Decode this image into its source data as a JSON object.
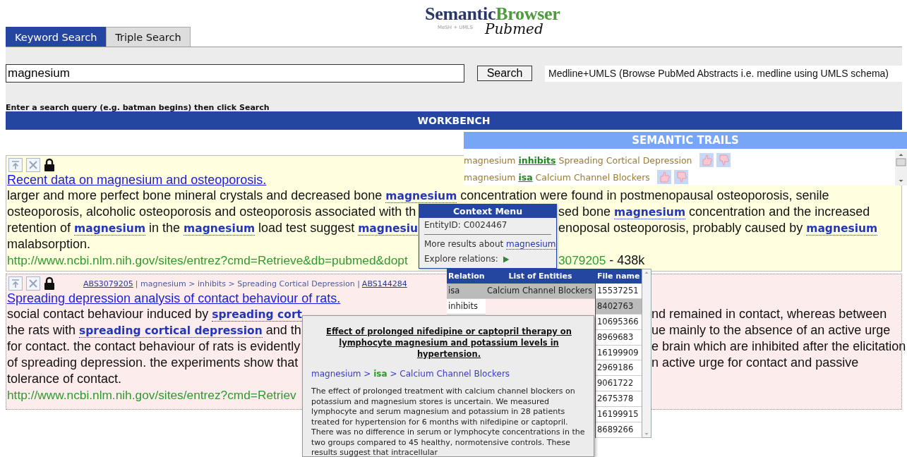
{
  "logo": {
    "title_parts": [
      "Semantic",
      "Browser"
    ],
    "tagline": "MeSH + UMLS",
    "script": "Pubmed"
  },
  "tabs": [
    {
      "label": "Keyword Search",
      "selected": true
    },
    {
      "label": "Triple Search",
      "selected": false
    }
  ],
  "search": {
    "value": "magnesium",
    "button": "Search",
    "source": "Medline+UMLS (Browse PubMed Abstracts i.e. medline using UMLS schema)",
    "hint": "Enter a search query (e.g. batman begins) then click Search"
  },
  "workbench": {
    "title": "WORKBENCH"
  },
  "results": [
    {
      "title": "Recent data on magnesium and osteoporosis.",
      "lines": [
        {
          "left": [
            {
              "kind": "text",
              "text": "larger and more perfect bone mineral crystals and decreased bone "
            },
            {
              "kind": "term",
              "text": "magnesium"
            },
            {
              "kind": "text",
              "text": " concentration were found in postmenopausal osteoporosis, senile"
            }
          ]
        },
        {
          "left": [
            {
              "kind": "text",
              "text": "osteoporosis, alcoholic osteoporosis and osteoporosis associated with th"
            }
          ],
          "right": [
            {
              "kind": "text",
              "text": "sed bone "
            },
            {
              "kind": "term",
              "text": "magnesium"
            },
            {
              "kind": "text",
              "text": " concentration and the increased"
            }
          ]
        },
        {
          "left": [
            {
              "kind": "text",
              "text": "retention of "
            },
            {
              "kind": "term",
              "text": "magnesium"
            },
            {
              "kind": "text",
              "text": " in the "
            },
            {
              "kind": "term",
              "text": "magnesium"
            },
            {
              "kind": "text",
              "text": " load test suggest "
            },
            {
              "kind": "term",
              "text": "magnesiu"
            }
          ],
          "right": [
            {
              "kind": "text",
              "text": "enoposal osteoporosis, probably caused by "
            },
            {
              "kind": "term",
              "text": "magnesium"
            }
          ]
        },
        {
          "left": [
            {
              "kind": "text",
              "text": "malabsorption."
            }
          ]
        },
        {
          "left": [
            {
              "kind": "url",
              "text": "http://www.ncbi.nlm.nih.gov/sites/entrez?cmd=Retrieve&db=pubmed&dopt"
            }
          ],
          "right": [
            {
              "kind": "url",
              "text": "3079205"
            },
            {
              "kind": "text",
              "text": " - 438k"
            }
          ]
        }
      ]
    },
    {
      "breadcrumb": {
        "prev": "ABS3079205",
        "path": "| magnesium > inhibits > Spreading Cortical Depression |",
        "next": "ABS144284"
      },
      "title": "Spreading depression analysis of contact behaviour of rats.",
      "lines": [
        {
          "left": [
            {
              "kind": "text",
              "text": "social contact behaviour induced by "
            },
            {
              "kind": "term",
              "text": "spreading cort"
            }
          ],
          "right": [
            {
              "kind": "text",
              "text": "nd remained in contact, whereas between"
            }
          ]
        },
        {
          "left": [
            {
              "kind": "text",
              "text": "the rats with "
            },
            {
              "kind": "term",
              "text": "spreading cortical depression"
            },
            {
              "kind": "text",
              "text": " and th"
            }
          ],
          "right": [
            {
              "kind": "text",
              "text": "ue mainly to the absence of an active urge"
            }
          ]
        },
        {
          "left": [
            {
              "kind": "text",
              "text": "for contact. the contact behaviour of rats is evidently"
            }
          ],
          "right": [
            {
              "kind": "text",
              "text": "e brain which are inhibited after the elicitation"
            }
          ]
        },
        {
          "left": [
            {
              "kind": "text",
              "text": "of spreading depression. the experiments show that"
            }
          ],
          "right": [
            {
              "kind": "text",
              "text": "n active urge for contact and passive"
            }
          ]
        },
        {
          "left": [
            {
              "kind": "text",
              "text": "tolerance of contact."
            }
          ]
        },
        {
          "left": [
            {
              "kind": "url",
              "text": "http://www.ncbi.nlm.nih.gov/sites/entrez?cmd=Retriev"
            }
          ]
        }
      ]
    }
  ],
  "semantic_trails": {
    "title": "SEMANTIC TRAILS",
    "items": [
      {
        "subject": "magnesium",
        "relation": "inhibits",
        "object": "Spreading Cortical Depression"
      },
      {
        "subject": "magnesium",
        "relation": "isa",
        "object": "Calcium Channel Blockers"
      }
    ]
  },
  "context_menu": {
    "title": "Context Menu",
    "entity_id": "EntityID: C0024467",
    "more_prefix": "More results about ",
    "more_link": "magnesium",
    "explore": "Explore relations:"
  },
  "entity_table": {
    "columns": [
      "Relation",
      "List of Entities",
      "File name"
    ],
    "relations": [
      {
        "label": "isa",
        "selected": true
      },
      {
        "label": "inhibits",
        "selected": false
      }
    ],
    "entities": [
      {
        "label": "Calcium Channel Blockers",
        "selected": true
      }
    ],
    "files": [
      {
        "label": "15537251",
        "selected": false
      },
      {
        "label": "8402763",
        "selected": true
      },
      {
        "label": "10695366",
        "selected": false
      },
      {
        "label": "8969683",
        "selected": false
      },
      {
        "label": "16199909",
        "selected": false
      },
      {
        "label": "2969186",
        "selected": false
      },
      {
        "label": "9061722",
        "selected": false
      },
      {
        "label": "2675378",
        "selected": false
      },
      {
        "label": "16199915",
        "selected": false
      },
      {
        "label": "8689266",
        "selected": false
      }
    ]
  },
  "abstract_popup": {
    "title": "Effect of prolonged nifedipine or captopril therapy on lymphocyte magnesium and potassium levels in hypertension.",
    "path": [
      {
        "kind": "entity",
        "text": "magnesium"
      },
      {
        "kind": "sep",
        "text": ">"
      },
      {
        "kind": "relation",
        "text": "isa"
      },
      {
        "kind": "sep",
        "text": ">"
      },
      {
        "kind": "entity",
        "text": "Calcium Channel Blockers"
      }
    ],
    "text": "The effect of prolonged treatment with calcium channel blockers on potassium and magnesium stores is uncertain. We measured lymphocyte and serum magnesium and potassium in 28 patients treated for hypertension for 6 months with nifedipine or captopril. There was no difference in serum or lymphocyte concentrations in the two groups compared to 45 healthy, normotensive controls. These results suggest that intracellular"
  }
}
